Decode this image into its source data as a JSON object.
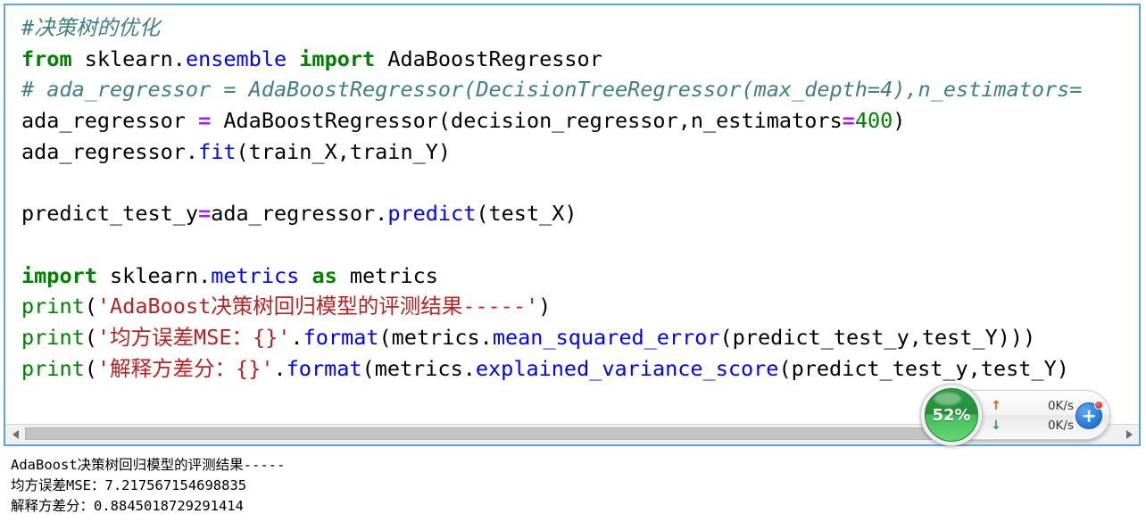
{
  "cell": {
    "border_color": "#5ba7dd",
    "lines": [
      [
        {
          "t": "#决策树的优化",
          "c": "comment"
        }
      ],
      [
        {
          "t": "from",
          "c": "kw"
        },
        {
          "t": " sklearn.",
          "c": "plain"
        },
        {
          "t": "ensemble",
          "c": "name"
        },
        {
          "t": " ",
          "c": "plain"
        },
        {
          "t": "import",
          "c": "kw"
        },
        {
          "t": " AdaBoostRegressor",
          "c": "plain"
        }
      ],
      [
        {
          "t": "# ada_regressor = AdaBoostRegressor(DecisionTreeRegressor(max_depth=4),n_estimators=",
          "c": "comment"
        }
      ],
      [
        {
          "t": "ada_regressor ",
          "c": "plain"
        },
        {
          "t": "=",
          "c": "op"
        },
        {
          "t": " AdaBoostRegressor(decision_regressor,n_estimators",
          "c": "plain"
        },
        {
          "t": "=",
          "c": "op"
        },
        {
          "t": "400",
          "c": "num"
        },
        {
          "t": ")",
          "c": "plain"
        }
      ],
      [
        {
          "t": "ada_regressor.",
          "c": "plain"
        },
        {
          "t": "fit",
          "c": "fn"
        },
        {
          "t": "(train_X,train_Y)",
          "c": "plain"
        }
      ],
      [
        {
          "t": "",
          "c": "plain"
        }
      ],
      [
        {
          "t": "predict_test_y",
          "c": "plain"
        },
        {
          "t": "=",
          "c": "op"
        },
        {
          "t": "ada_regressor.",
          "c": "plain"
        },
        {
          "t": "predict",
          "c": "fn"
        },
        {
          "t": "(test_X)",
          "c": "plain"
        }
      ],
      [
        {
          "t": "",
          "c": "plain"
        }
      ],
      [
        {
          "t": "import",
          "c": "kw"
        },
        {
          "t": " sklearn.",
          "c": "plain"
        },
        {
          "t": "metrics",
          "c": "name"
        },
        {
          "t": " ",
          "c": "plain"
        },
        {
          "t": "as",
          "c": "kw"
        },
        {
          "t": " metrics",
          "c": "plain"
        }
      ],
      [
        {
          "t": "print",
          "c": "builtin"
        },
        {
          "t": "(",
          "c": "plain"
        },
        {
          "t": "'AdaBoost决策树回归模型的评测结果-----'",
          "c": "str"
        },
        {
          "t": ")",
          "c": "plain"
        }
      ],
      [
        {
          "t": "print",
          "c": "builtin"
        },
        {
          "t": "(",
          "c": "plain"
        },
        {
          "t": "'均方误差MSE：{}'",
          "c": "str"
        },
        {
          "t": ".",
          "c": "plain"
        },
        {
          "t": "format",
          "c": "fn"
        },
        {
          "t": "(metrics.",
          "c": "plain"
        },
        {
          "t": "mean_squared_error",
          "c": "fn"
        },
        {
          "t": "(predict_test_y,test_Y)))",
          "c": "plain"
        }
      ],
      [
        {
          "t": "print",
          "c": "builtin"
        },
        {
          "t": "(",
          "c": "plain"
        },
        {
          "t": "'解释方差分：{}'",
          "c": "str"
        },
        {
          "t": ".",
          "c": "plain"
        },
        {
          "t": "format",
          "c": "fn"
        },
        {
          "t": "(metrics.",
          "c": "plain"
        },
        {
          "t": "explained_variance_score",
          "c": "fn"
        },
        {
          "t": "(predict_test_y,test_Y)",
          "c": "plain"
        }
      ]
    ],
    "scrollbar": {
      "left_arrow": "◀",
      "right_arrow": "▶",
      "thumb_percent": 96
    }
  },
  "output": {
    "lines": [
      "AdaBoost决策树回归模型的评测结果-----",
      "均方误差MSE：7.217567154698835",
      "解释方差分：0.8845018729291414"
    ]
  },
  "net_widget": {
    "gauge_percent": "52%",
    "upload_arrow": "↑",
    "upload_speed": "0K/s",
    "download_arrow": "↓",
    "download_speed": "0K/s",
    "plus_label": "+",
    "colors": {
      "gauge_green": "#3fbd56",
      "upload_arrow": "#e8590c",
      "download_arrow": "#2f9e44",
      "plus_blue": "#2f7fe0",
      "badge_red": "#e03131"
    }
  }
}
